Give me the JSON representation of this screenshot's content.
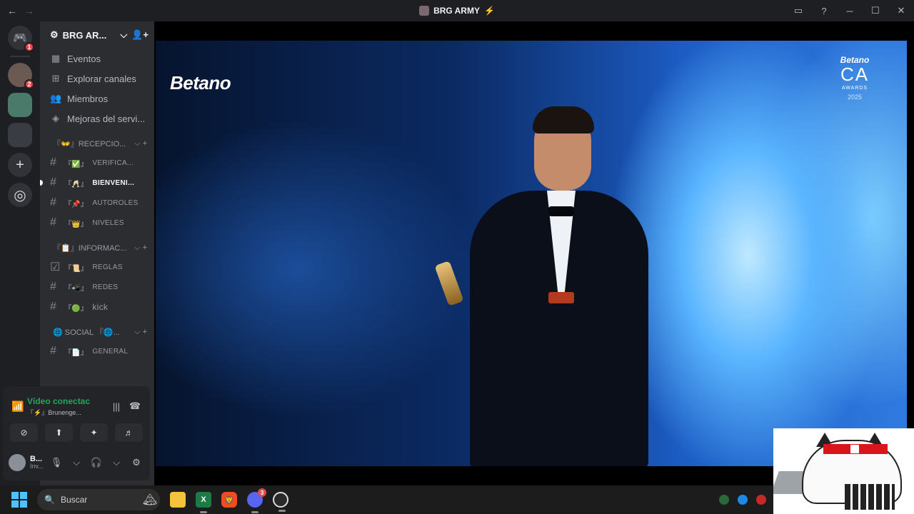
{
  "window": {
    "title": "BRG ARMY",
    "back_icon": "←",
    "forward_icon": "→",
    "inbox_icon": "▭",
    "help_icon": "?",
    "minimize_icon": "─",
    "maximize_icon": "☐",
    "close_icon": "✕"
  },
  "rail": {
    "home_badge": "1",
    "server1_badge": "2",
    "add_icon": "+",
    "explore_icon": "◎"
  },
  "server": {
    "name": "BRG AR...",
    "chevron": "⌵",
    "invite_icon": "👤+"
  },
  "nav": [
    {
      "icon": "▦",
      "label": "Eventos"
    },
    {
      "icon": "⊞",
      "label": "Explorar canales"
    },
    {
      "icon": "👥",
      "label": "Miembros"
    },
    {
      "icon": "◈",
      "label": "Mejoras del servi..."
    }
  ],
  "categories": [
    {
      "label": "『👐』RECEPCIO...",
      "controls": "⌵ +"
    },
    {
      "label": "『📋』INFORMAC...",
      "controls": "⌵ +"
    },
    {
      "label": "🌐 SOCIAL 『🌐...",
      "controls": "⌵ +"
    }
  ],
  "channels": [
    {
      "icon": "#",
      "emoji": "『✅』",
      "label": "VERIFICA..."
    },
    {
      "icon": "#",
      "emoji": "『🥂』",
      "label": "BIENVENI..."
    },
    {
      "icon": "#",
      "emoji": "『📌』",
      "label": "AUTOROLES"
    },
    {
      "icon": "#",
      "emoji": "『👑』",
      "label": "NIVELES"
    },
    {
      "icon": "☑",
      "emoji": "『📜』",
      "label": "REGLAS"
    },
    {
      "icon": "#",
      "emoji": "『📲』",
      "label": "REDES"
    },
    {
      "icon": "#",
      "emoji": "『🟢』",
      "label": "kick"
    },
    {
      "icon": "#",
      "emoji": "『📄』",
      "label": "GENERAL"
    }
  ],
  "voice": {
    "status": "Vídeo conectac",
    "channel": "『⚡』Brunenge...",
    "signal_icon": "📶",
    "waveform_icon": "|||",
    "disconnect_icon": "☎",
    "buttons": [
      {
        "name": "camera-off",
        "icon": "⊘"
      },
      {
        "name": "screen-share",
        "icon": "⬆"
      },
      {
        "name": "activities",
        "icon": "✦"
      },
      {
        "name": "soundboard",
        "icon": "♬"
      }
    ]
  },
  "user": {
    "name": "B...",
    "status": "Inv...",
    "mic_icon": "🎙",
    "headset_icon": "🎧",
    "settings_icon": "⚙",
    "chevron": "⌵"
  },
  "stream": {
    "sponsor": "Betano",
    "award_brand": "Betano",
    "award_title": "CA",
    "award_subtitle": "AWARDS",
    "award_year": "2025"
  },
  "taskbar": {
    "search_placeholder": "Buscar",
    "search_icon": "🔍",
    "discord_badge": "3",
    "apps": [
      "files",
      "excel",
      "brave",
      "discord",
      "obs"
    ]
  },
  "colors": {
    "rail_bg": "#1e1f22",
    "sidebar_bg": "#2b2d31",
    "voice_green": "#23a55a",
    "badge_red": "#f23f43",
    "discord_blurple": "#5865f2"
  }
}
